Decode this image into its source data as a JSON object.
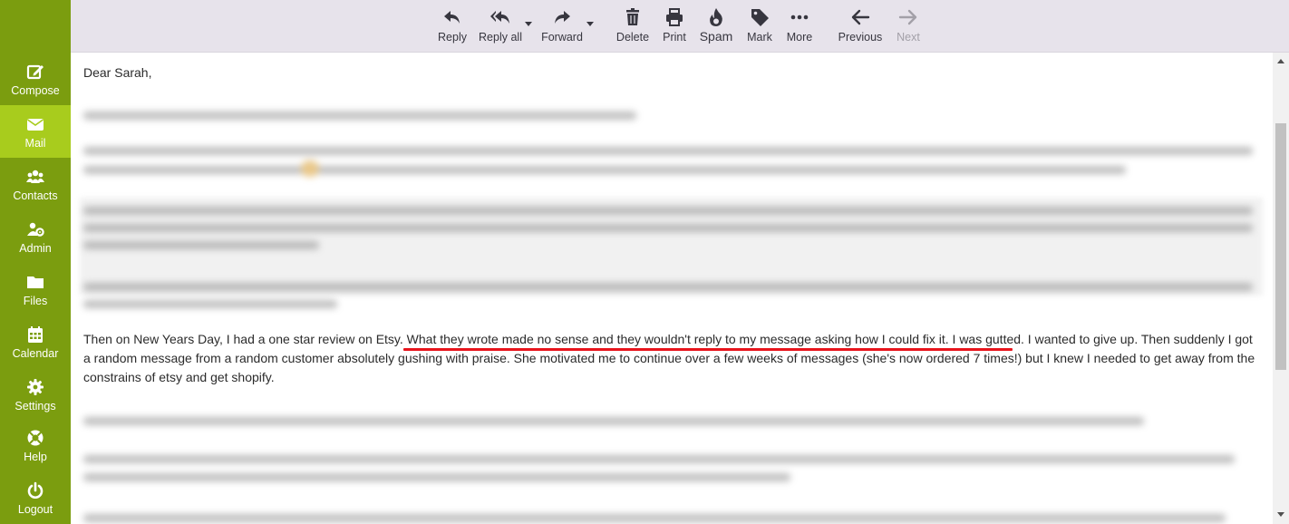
{
  "sidebar": {
    "items": [
      {
        "label": "Compose",
        "icon": "compose-icon",
        "active": false
      },
      {
        "label": "Mail",
        "icon": "mail-icon",
        "active": true
      },
      {
        "label": "Contacts",
        "icon": "contacts-icon",
        "active": false
      },
      {
        "label": "Admin",
        "icon": "admin-icon",
        "active": false
      },
      {
        "label": "Files",
        "icon": "folder-icon",
        "active": false
      },
      {
        "label": "Calendar",
        "icon": "calendar-icon",
        "active": false
      },
      {
        "label": "Settings",
        "icon": "gear-icon",
        "active": false
      },
      {
        "label": "Help",
        "icon": "lifebuoy-icon",
        "active": false
      },
      {
        "label": "Logout",
        "icon": "power-icon",
        "active": false
      }
    ]
  },
  "toolbar": {
    "reply": "Reply",
    "reply_all": "Reply all",
    "forward": "Forward",
    "delete": "Delete",
    "print": "Print",
    "spam": "Spam",
    "mark": "Mark",
    "more": "More",
    "previous": "Previous",
    "next": "Next"
  },
  "message": {
    "greeting": "Dear Sarah,",
    "paragraph_1": "Then on New Years Day, I had a one star review on Etsy. What they wrote made no sense and they wouldn't reply to my message asking how I could fix it. I was gutted. I wanted to give up. Then suddenly I got a random message from a random customer absolutely gushing with praise. She motivated me to continue over a few weeks of messages (she's now ordered 7 times!) but I knew I needed to get away from the constrains of etsy and get shopify."
  },
  "colors": {
    "sidebar": "#7b9d0f",
    "sidebar_active": "#a8cc1d",
    "toolbar": "#e7e3eb",
    "underline": "#e8141c"
  }
}
